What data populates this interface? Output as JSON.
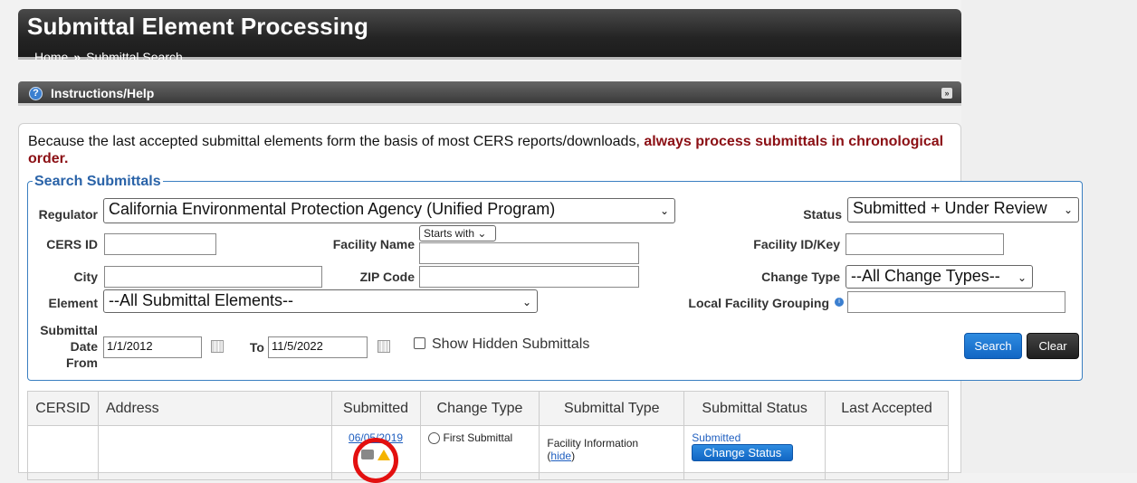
{
  "header": {
    "title": "Submittal Element Processing",
    "breadcrumb": {
      "home": "Home",
      "separator": "»",
      "current": "Submittal Search"
    }
  },
  "help": {
    "label": "Instructions/Help"
  },
  "notice": {
    "text": "Because the last accepted submittal elements form the basis of most CERS reports/downloads, ",
    "emphasis": "always process submittals in chronological order",
    "end": "."
  },
  "search": {
    "legend": "Search Submittals",
    "regulator_label": "Regulator",
    "regulator_value": "California Environmental Protection Agency (Unified Program)",
    "status_label": "Status",
    "status_value": "Submitted + Under Review",
    "cersid_label": "CERS ID",
    "cersid_value": "",
    "facility_name_label": "Facility Name",
    "facility_match_value": "Starts with",
    "facility_name_value": "",
    "facility_id_label": "Facility ID/Key",
    "facility_id_value": "",
    "city_label": "City",
    "city_value": "",
    "zip_label": "ZIP Code",
    "zip_value": "",
    "change_type_label": "Change Type",
    "change_type_value": "--All Change Types--",
    "element_label": "Element",
    "element_value": "--All Submittal Elements--",
    "local_grouping_label": "Local Facility Grouping",
    "local_grouping_value": "",
    "date_from_label_1": "Submittal",
    "date_from_label_2": "Date",
    "date_from_label_3": "From",
    "date_from_value": "1/1/2012",
    "date_to_label": "To",
    "date_to_value": "11/5/2022",
    "show_hidden_label": "Show Hidden Submittals",
    "search_button": "Search",
    "clear_button": "Clear"
  },
  "results": {
    "columns": [
      "CERSID",
      "Address",
      "Submitted",
      "Change Type",
      "Submittal Type",
      "Submittal Status",
      "Last Accepted"
    ],
    "rows": [
      {
        "submitted_date": "06/05/2019",
        "change_type": "First Submittal",
        "submittal_type": "Facility Information",
        "hide_link": "hide",
        "status": "Submitted",
        "change_status_button": "Change Status"
      }
    ]
  },
  "colors": {
    "accent": "#1166c4",
    "notice_emphasis": "#8b0f14",
    "highlight_ring": "#e31010",
    "warning": "#f5b400"
  },
  "icons": [
    "help-icon",
    "collapse-icon",
    "calendar-icon",
    "info-icon",
    "print-icon",
    "warning-icon",
    "chevron-down-icon"
  ]
}
